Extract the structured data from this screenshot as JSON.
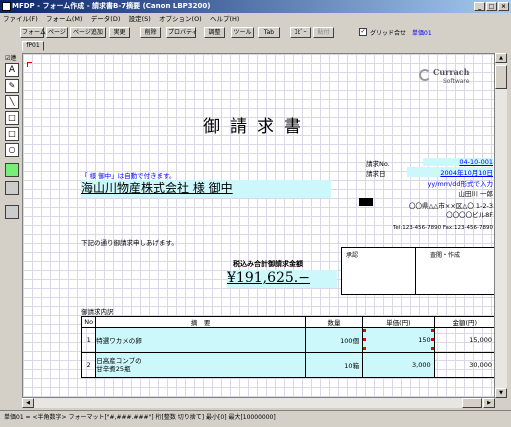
{
  "window": {
    "title": "MFDP - フォーム作成 - 請求書B-7摘要 (Canon LBP3200)",
    "min": "_",
    "max": "□",
    "close": "×"
  },
  "menu": [
    "ファイル(F)",
    "フォーム(M)",
    "データ(D)",
    "設定(S)",
    "オプション(O)",
    "ヘルプ(H)"
  ],
  "toolbar": {
    "buttons": [
      "フォーム",
      "ページ",
      "ページ追加",
      "実更",
      "削除",
      "プロパティ",
      "調整",
      "ツール",
      "Tab",
      "ｺﾋﾟｰ",
      "貼付"
    ],
    "grid_label": "グリッド合せ",
    "cell_label": "単価01"
  },
  "tab": "fP01",
  "tools": {
    "check_label": "連",
    "text": "A",
    "pen": "✎",
    "line": "╲",
    "rect": "□",
    "rect2": "□",
    "ellipse": "○"
  },
  "doc": {
    "title": "御請求書",
    "logo": {
      "name": "Currach",
      "sub": "Software"
    },
    "auto_note": "「 様 御中」は自動で付きます。",
    "customer": "海山川物産株式会社 様 御中",
    "invoice_no_label": "請求No.",
    "invoice_no": "04-10-001",
    "invoice_date_label": "請求日",
    "invoice_date": "2004年10月10日",
    "format_note": "yy/mm/dd形式で入力",
    "sender": "山田川 一郎",
    "addr1": "〇〇県△△市××区△〇 1-2-3",
    "addr2": "〇〇〇〇ビル8F",
    "tel": "Tel:123-456-7890 Fax:123-456-7890",
    "intro": "下記の通り御請求申しあげます。",
    "total_label": "税込み合計御請求金額",
    "total": "¥191,625.−",
    "stamp": {
      "approve": "承認",
      "check": "査閲・作成"
    },
    "detail_label": "御請求内訳",
    "columns": {
      "no": "No",
      "desc": "摘　要",
      "qty": "数量",
      "price": "単価(円)",
      "amount": "金額(円)"
    },
    "rows": [
      {
        "no": "1",
        "desc": "特選ワカメの卵",
        "qty": "100個",
        "price": "150",
        "amount": "15,000"
      },
      {
        "no": "2",
        "desc": "日高産コンブの\n甘辛煮25瓶",
        "qty": "10箱",
        "price": "3,000",
        "amount": "30,000"
      }
    ]
  },
  "status": "単価01 = <半角数字> フォーマット[\"#,###.###\"] 桁[整数 切り捨て] 最小[0] 最大[10000000]"
}
